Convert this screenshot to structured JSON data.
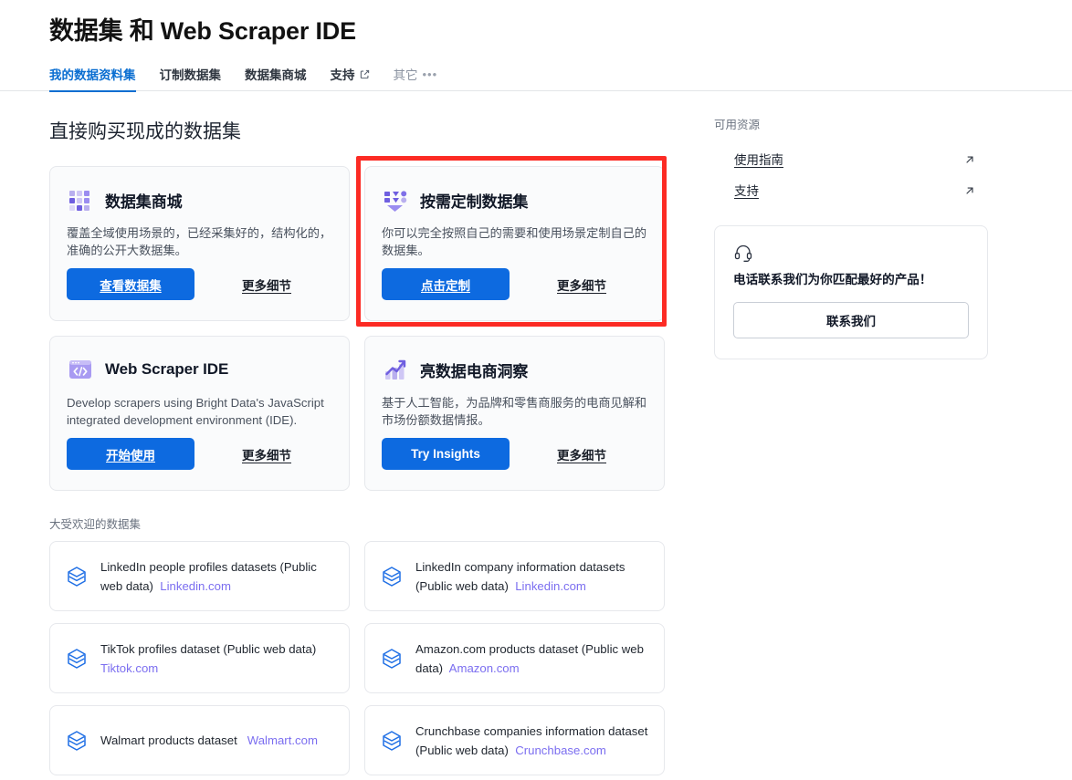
{
  "header": {
    "title": "数据集 和 Web Scraper IDE"
  },
  "tabs": [
    {
      "label": "我的数据资料集",
      "active": true,
      "external": false,
      "muted": false
    },
    {
      "label": "订制数据集",
      "active": false,
      "external": false,
      "muted": false
    },
    {
      "label": "数据集商城",
      "active": false,
      "external": false,
      "muted": false
    },
    {
      "label": "支持",
      "active": false,
      "external": true,
      "muted": false
    },
    {
      "label": "其它",
      "active": false,
      "external": false,
      "muted": true
    }
  ],
  "main": {
    "section_title": "直接购买现成的数据集",
    "cards": [
      {
        "icon": "grid-squares-icon",
        "title": "数据集商城",
        "description": "覆盖全域使用场景的，已经采集好的，结构化的，准确的公开大数据集。",
        "primary_label": "查看数据集",
        "more_label": "更多细节",
        "highlighted": false
      },
      {
        "icon": "funnel-filter-icon",
        "title": "按需定制数据集",
        "description": "你可以完全按照自己的需要和使用场景定制自己的数据集。",
        "primary_label": "点击定制",
        "more_label": "更多细节",
        "highlighted": true
      },
      {
        "icon": "code-window-icon",
        "title": "Web Scraper IDE",
        "description": "Develop scrapers using Bright Data's JavaScript integrated development environment (IDE).",
        "primary_label": "开始使用",
        "more_label": "更多细节",
        "highlighted": false
      },
      {
        "icon": "bar-chart-arrow-icon",
        "title": "亮数据电商洞察",
        "description": "基于人工智能，为品牌和零售商服务的电商见解和市场份额数据情报。",
        "primary_label": "Try Insights",
        "more_label": "更多细节",
        "highlighted": false
      }
    ],
    "popular_label": "大受欢迎的数据集",
    "popular_datasets": [
      {
        "icon": "dataset-stack-icon",
        "name": "LinkedIn people profiles datasets (Public web data)",
        "domain": "Linkedin.com"
      },
      {
        "icon": "dataset-stack-icon",
        "name": "LinkedIn company information datasets (Public web data)",
        "domain": "Linkedin.com"
      },
      {
        "icon": "dataset-stack-icon",
        "name": "TikTok profiles dataset (Public web data)",
        "domain": "Tiktok.com"
      },
      {
        "icon": "dataset-stack-icon",
        "name": "Amazon.com products dataset (Public web data)",
        "domain": "Amazon.com"
      },
      {
        "icon": "dataset-stack-icon",
        "name": "Walmart products dataset",
        "domain": "Walmart.com"
      },
      {
        "icon": "dataset-stack-icon",
        "name": "Crunchbase companies information dataset (Public web data)",
        "domain": "Crunchbase.com"
      }
    ]
  },
  "sidebar": {
    "resources_label": "可用资源",
    "links": [
      {
        "label": "使用指南",
        "icon": "external-arrow-icon"
      },
      {
        "label": "支持",
        "icon": "external-arrow-icon"
      }
    ],
    "contact": {
      "icon": "headset-icon",
      "title": "电话联系我们为你匹配最好的产品！",
      "button_label": "联系我们"
    }
  },
  "colors": {
    "accent_blue": "#0d6ae0",
    "tab_active": "#0a6ed1",
    "highlight_red": "#fc2b24",
    "link_purple": "#7b6ef0",
    "icon_purple": "#9b8df0",
    "dataset_icon_blue": "#1f6fe5"
  }
}
